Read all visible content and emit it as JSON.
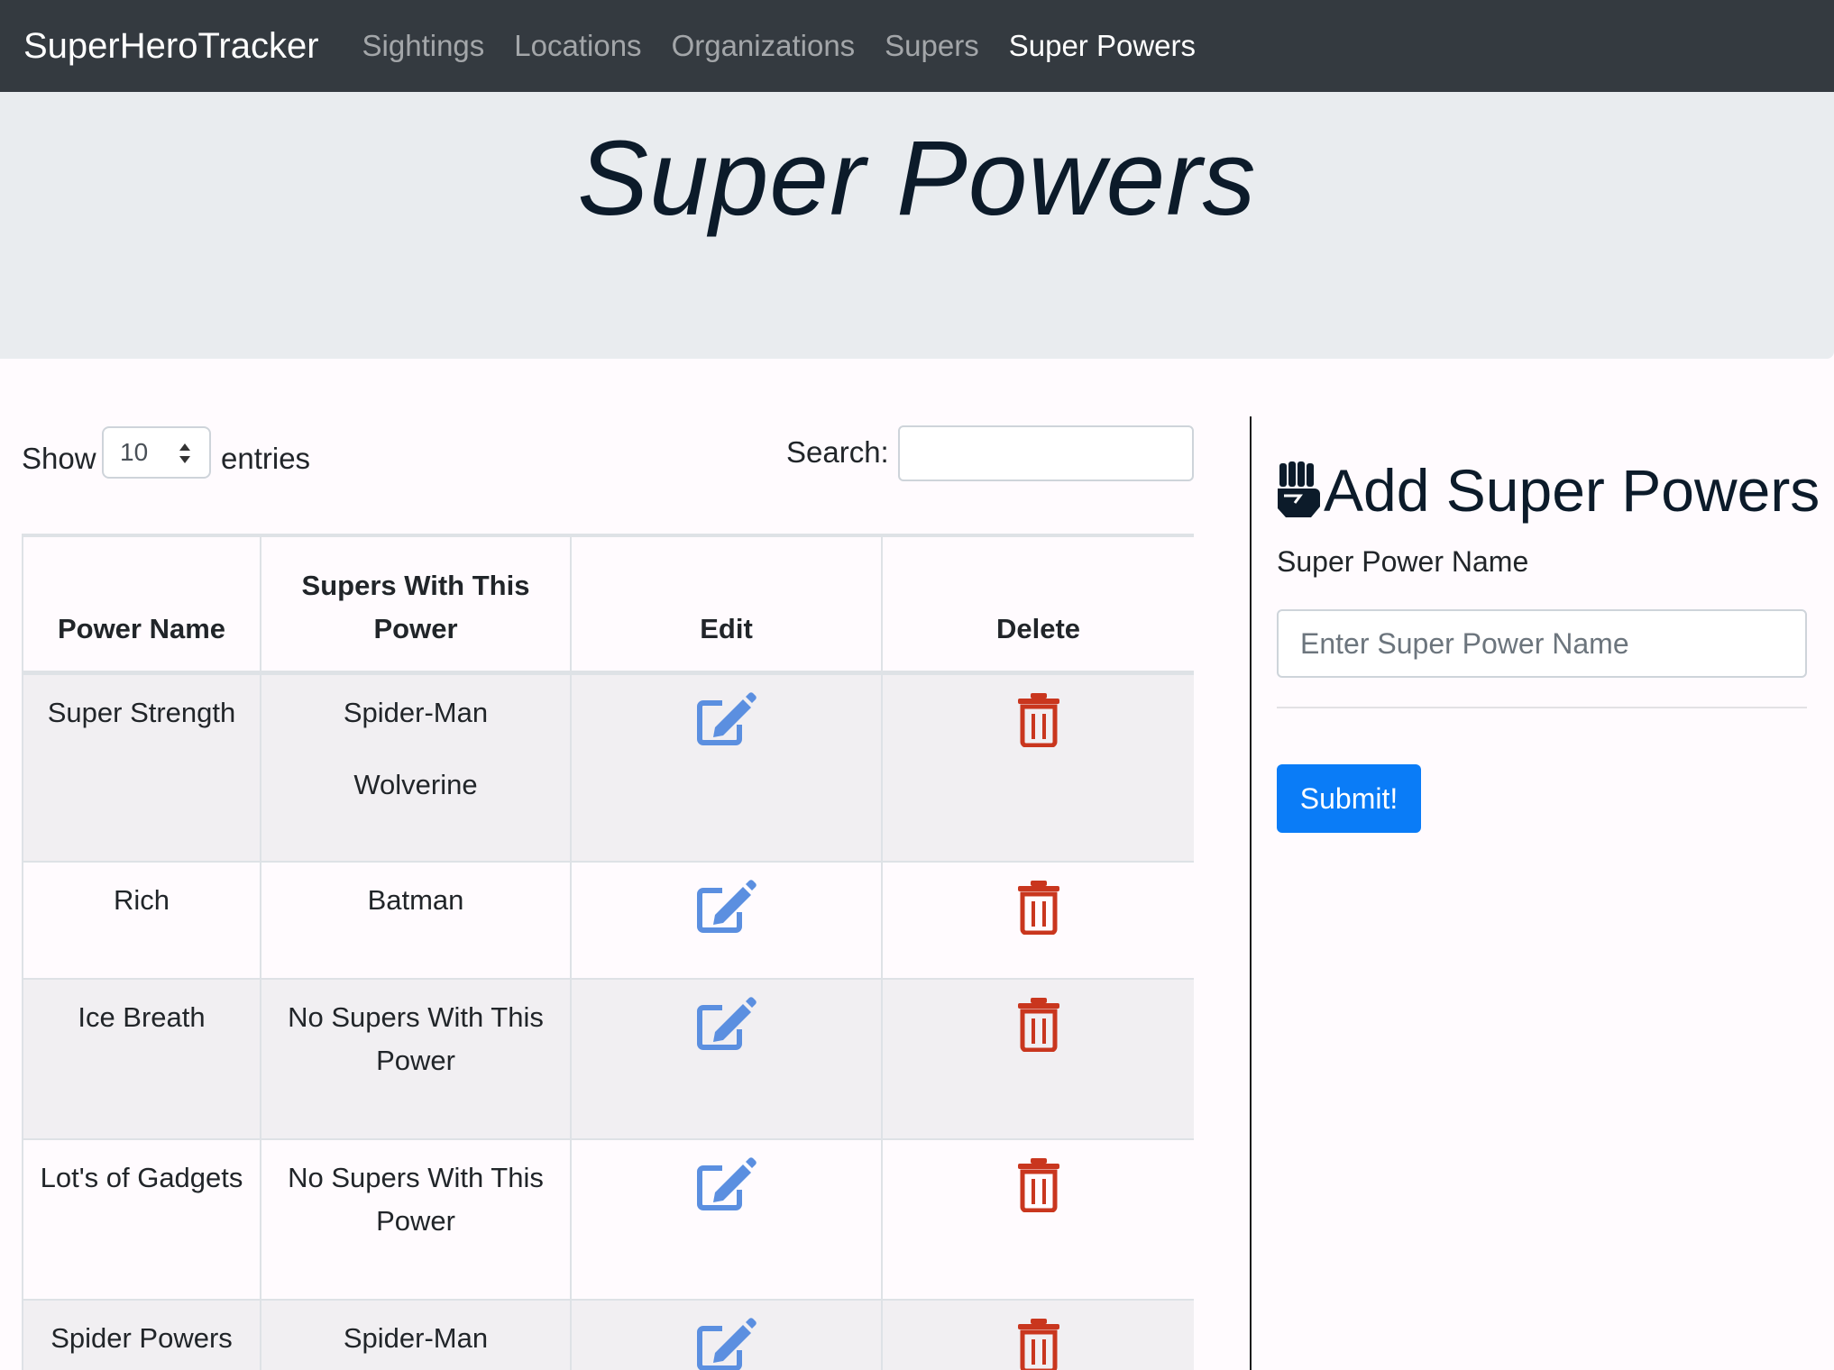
{
  "navbar": {
    "brand": "SuperHeroTracker",
    "links": [
      {
        "label": "Sightings",
        "active": false
      },
      {
        "label": "Locations",
        "active": false
      },
      {
        "label": "Organizations",
        "active": false
      },
      {
        "label": "Supers",
        "active": false
      },
      {
        "label": "Super Powers",
        "active": true
      }
    ]
  },
  "page": {
    "title": "Super Powers"
  },
  "table_controls": {
    "show_label": "Show",
    "entries_value": "10",
    "entries_label": "entries",
    "search_label": "Search:",
    "search_value": ""
  },
  "table": {
    "headers": [
      "Power Name",
      "Supers With This Power",
      "Edit",
      "Delete"
    ],
    "rows": [
      {
        "power": "Super Strength",
        "supers": [
          "Spider-Man",
          "Wolverine"
        ]
      },
      {
        "power": "Rich",
        "supers": [
          "Batman"
        ]
      },
      {
        "power": "Ice Breath",
        "supers": [
          "No Supers With This Power"
        ]
      },
      {
        "power": "Lot's of Gadgets",
        "supers": [
          "No Supers With This Power"
        ]
      },
      {
        "power": "Spider Powers",
        "supers": [
          "Spider-Man"
        ]
      }
    ]
  },
  "form": {
    "title": "Add Super Powers",
    "field_label": "Super Power Name",
    "placeholder": "Enter Super Power Name",
    "submit_label": "Submit!"
  },
  "icons": {
    "edit": "edit-icon",
    "delete": "trash-icon",
    "form_title": "fist-icon"
  },
  "colors": {
    "navbar_bg": "#343a40",
    "edit_icon": "#5b8fe0",
    "delete_icon": "#c9361e",
    "submit_bg": "#0a7cf7"
  }
}
